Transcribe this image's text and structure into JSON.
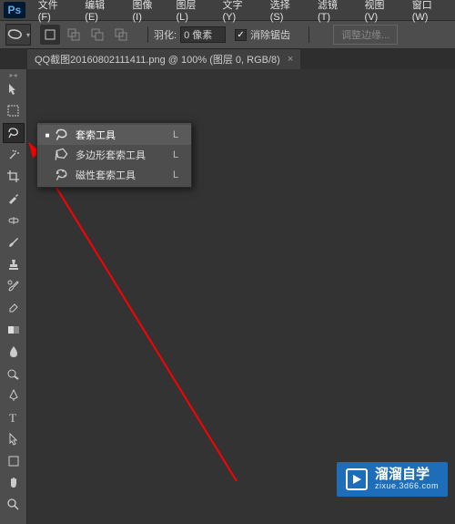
{
  "menu": [
    "文件(F)",
    "编辑(E)",
    "图像(I)",
    "图层(L)",
    "文字(Y)",
    "选择(S)",
    "滤镜(T)",
    "视图(V)",
    "窗口(W)"
  ],
  "options": {
    "feather_label": "羽化:",
    "feather_value": "0 像素",
    "antialias_label": "消除锯齿",
    "refine_label": "调整边缘..."
  },
  "doc_tab": {
    "title": "QQ截图20160802111411.png @ 100% (图层 0, RGB/8)",
    "close": "×"
  },
  "flyout": {
    "items": [
      {
        "label": "套索工具",
        "key": "L",
        "active": true
      },
      {
        "label": "多边形套索工具",
        "key": "L",
        "active": false
      },
      {
        "label": "磁性套索工具",
        "key": "L",
        "active": false
      }
    ]
  },
  "watermark": {
    "title": "溜溜自学",
    "url": "zixue.3d66.com"
  },
  "logo": "Ps"
}
